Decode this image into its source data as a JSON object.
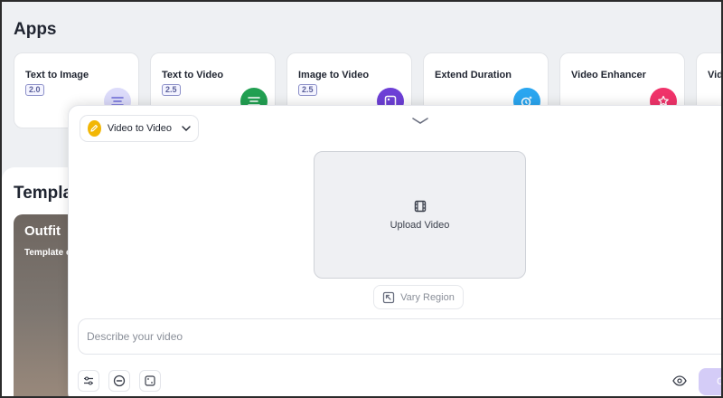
{
  "apps": {
    "title": "Apps",
    "items": [
      {
        "name": "Text to Image",
        "version": "2.0",
        "icon": "text-lines-icon",
        "color": "#c8c6f5"
      },
      {
        "name": "Text to Video",
        "version": "2.5",
        "icon": "text-lines-icon",
        "color": "#22a052"
      },
      {
        "name": "Image to Video",
        "version": "2.5",
        "icon": "image-icon",
        "color": "#6d3fd6"
      },
      {
        "name": "Extend Duration",
        "version": "",
        "icon": "clock-sparkle-icon",
        "color": "#2aa6f0"
      },
      {
        "name": "Video Enhancer",
        "version": "",
        "icon": "star-sparkle-icon",
        "color": "#f0336a"
      },
      {
        "name": "Vid",
        "version": "",
        "icon": "",
        "color": ""
      }
    ]
  },
  "templates": {
    "title": "Templa",
    "card": {
      "title": "Outfit",
      "subtitle": "Template c"
    }
  },
  "panel": {
    "mode": {
      "label": "Video to Video",
      "icon": "pencil-icon",
      "color": "#f2b705"
    },
    "upload": {
      "label": "Upload Video",
      "icon": "film-icon"
    },
    "vary_region": {
      "label": "Vary Region",
      "icon": "region-arrow-icon"
    },
    "prompt": {
      "placeholder": "Describe your video",
      "value": ""
    },
    "toolbar": {
      "settings_icon": "sliders-icon",
      "negative_icon": "minus-circle-icon",
      "seed_icon": "dice-icon",
      "preview_icon": "eye-icon",
      "create_label": "C",
      "create_color": "#d4ccf7"
    }
  }
}
